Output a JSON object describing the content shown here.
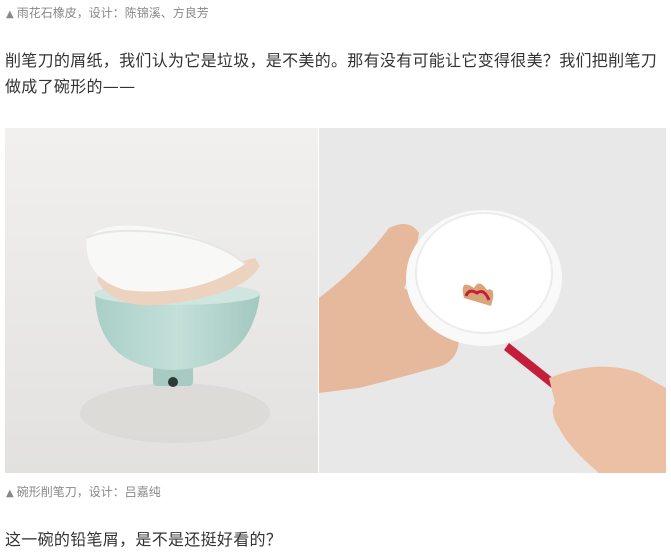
{
  "caption_top": {
    "marker": "▲",
    "text": "雨花石橡皮，设计：陈锦溪、方良芳"
  },
  "paragraph_1": "削笔刀的屑纸，我们认为它是垃圾，是不美的。那有没有可能让它变得很美？我们把削笔刀做成了碗形的——",
  "images": {
    "left": {
      "description_icon": "stacked-bowl-sharpener-photo"
    },
    "right": {
      "description_icon": "hands-holding-bowl-with-pencil-photo"
    }
  },
  "caption_bottom": {
    "marker": "▲",
    "text": "碗形削笔刀，设计：吕嘉纯"
  },
  "paragraph_2": "这一碗的铅笔屑，是不是还挺好看的？",
  "colors": {
    "caption_text": "#888888",
    "body_text": "#333333",
    "photo_background": "#e9e8e6",
    "bowl_mint": "#b9d9d1",
    "bowl_peach": "#ecd3bf",
    "pencil_red": "#c41e3a"
  }
}
